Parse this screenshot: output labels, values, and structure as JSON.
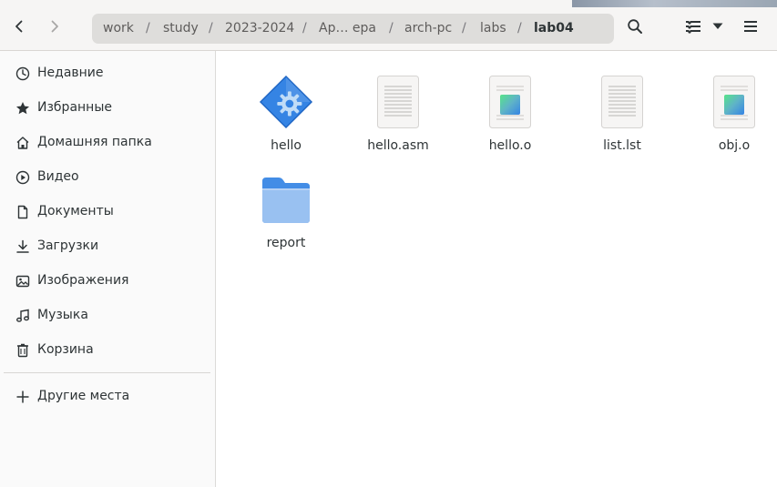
{
  "window": {
    "title": "lab04"
  },
  "header": {
    "back_icon": "chevron-left-icon",
    "forward_icon": "chevron-right-icon",
    "breadcrumbs": [
      {
        "label": "work"
      },
      {
        "label": "study"
      },
      {
        "label": "2023-2024"
      },
      {
        "label": "Ар… ера"
      },
      {
        "label": "arch-pc"
      },
      {
        "label": "labs"
      },
      {
        "label": "lab04"
      }
    ],
    "separator": "/",
    "path_menu_icon": "vertical-dots-icon",
    "search_icon": "search-icon",
    "view_icon": "list-view-icon",
    "view_dropdown_icon": "dropdown-triangle-icon",
    "menu_icon": "hamburger-menu-icon"
  },
  "sidebar": {
    "items": [
      {
        "label": "Недавние",
        "icon": "clock-icon"
      },
      {
        "label": "Избранные",
        "icon": "star-icon"
      },
      {
        "label": "Домашняя папка",
        "icon": "home-icon"
      },
      {
        "label": "Видео",
        "icon": "video-icon"
      },
      {
        "label": "Документы",
        "icon": "document-icon"
      },
      {
        "label": "Загрузки",
        "icon": "download-icon"
      },
      {
        "label": "Изображения",
        "icon": "image-icon"
      },
      {
        "label": "Музыка",
        "icon": "music-icon"
      },
      {
        "label": "Корзина",
        "icon": "trash-icon"
      }
    ],
    "other_locations": {
      "label": "Другие места",
      "icon": "plus-icon"
    }
  },
  "files": [
    {
      "name": "hello",
      "type": "executable"
    },
    {
      "name": "hello.asm",
      "type": "text"
    },
    {
      "name": "hello.o",
      "type": "object"
    },
    {
      "name": "list.lst",
      "type": "text"
    },
    {
      "name": "obj.o",
      "type": "object"
    },
    {
      "name": "report",
      "type": "folder"
    }
  ],
  "colors": {
    "headerbar": "#f6f5f4",
    "pathbar": "#dedddb",
    "sidebar": "#fafafa",
    "folder": "#9cc3ef",
    "executable": "#3584e4"
  }
}
